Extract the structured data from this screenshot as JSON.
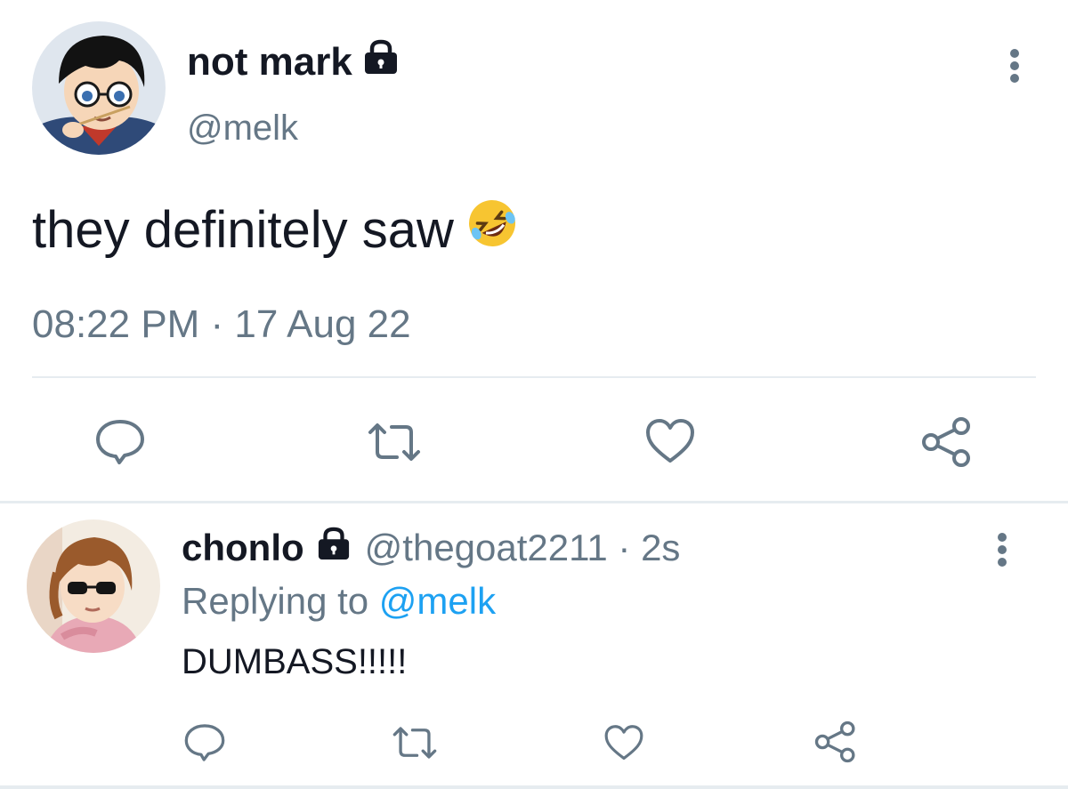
{
  "tweet": {
    "display_name": "not mark",
    "handle": "@melk",
    "text": "they definitely saw",
    "emoji": "rolling-on-floor-laughing",
    "timestamp": "08:22 PM · 17 Aug 22",
    "locked": true
  },
  "reply": {
    "display_name": "chonlo",
    "handle_time": "@thegoat2211 · 2s",
    "replying_prefix": "Replying to",
    "replying_mention": "@melk",
    "text": "DUMBASS!!!!!",
    "locked": true
  },
  "icons": {
    "reply": "comment-icon",
    "retweet": "retweet-icon",
    "like": "heart-icon",
    "share": "share-icon",
    "more": "more-vertical-icon",
    "lock": "lock-icon"
  },
  "colors": {
    "text": "#141823",
    "secondary": "#657786",
    "link": "#1da1f2",
    "divider": "#e6ecf0"
  }
}
